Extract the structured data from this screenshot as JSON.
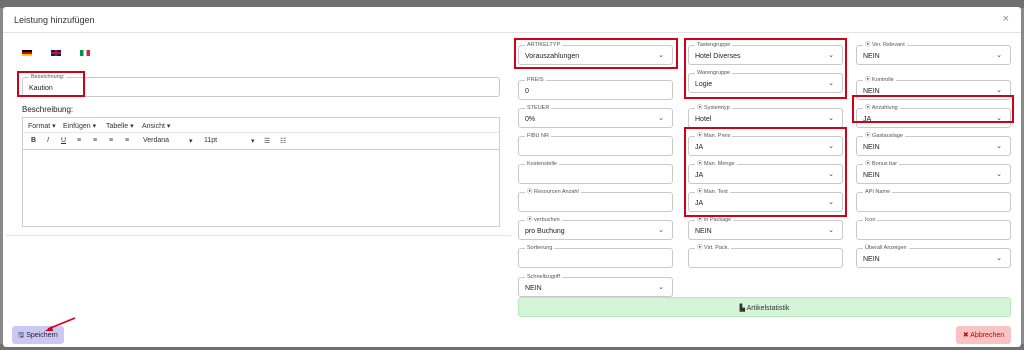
{
  "modal": {
    "title": "Leistung hinzufügen",
    "close": "×"
  },
  "flags": [
    "de",
    "gb",
    "it"
  ],
  "bezeichnung": {
    "label": "Bezeichnung:",
    "value": "Kaution"
  },
  "beschreibung": {
    "label": "Beschreibung:"
  },
  "editor": {
    "menu": [
      "Format",
      "Einfügen",
      "Tabelle",
      "Ansicht"
    ],
    "bold": "B",
    "italic": "I",
    "underline": "U",
    "font": "Verdana",
    "size": "11pt"
  },
  "col1": {
    "artikeltyp": {
      "label": "ARTIKELTYP",
      "value": "Vorauszahlungen"
    },
    "preis": {
      "label": "PREIS",
      "value": "0"
    },
    "steuer": {
      "label": "STEUER",
      "value": "0%"
    },
    "fibu": {
      "label": "FIBU NR",
      "value": ""
    },
    "kostenstelle": {
      "label": "Kostenstelle",
      "value": ""
    },
    "resourcen": {
      "label": "⦿ Resourcen Anzahl",
      "value": ""
    },
    "verbuchen": {
      "label": "⦿ verbuchen",
      "value": "pro Buchung"
    },
    "sortierung": {
      "label": "Sortierung",
      "value": ""
    },
    "schnellzugriff": {
      "label": "Schnellzugriff",
      "value": "NEIN"
    }
  },
  "col2": {
    "tastengruppe": {
      "label": "Tastengruppe",
      "value": "Hotel Diverses"
    },
    "warengruppe": {
      "label": "Warengruppe",
      "value": "Logie"
    },
    "systemtyp": {
      "label": "⦿ Systemtyp",
      "value": "Hotel"
    },
    "manpreis": {
      "label": "⦿ Man. Preis",
      "value": "JA"
    },
    "manmenge": {
      "label": "⦿ Man. Menge",
      "value": "JA"
    },
    "mantext": {
      "label": "⦿ Man. Text",
      "value": "JA"
    },
    "inpackage": {
      "label": "⦿ in Package",
      "value": "NEIN"
    },
    "virtpack": {
      "label": "⦿ Virt. Pack.",
      "value": ""
    }
  },
  "col3": {
    "verrelevant": {
      "label": "⦿ Ver. Relevant",
      "value": "NEIN"
    },
    "kontrolle": {
      "label": "⦿ Kontrolle",
      "value": "NEIN"
    },
    "anzahlung": {
      "label": "⦿ Anzahlung",
      "value": "JA"
    },
    "gastauslage": {
      "label": "⦿ Gastauslage",
      "value": "NEIN"
    },
    "bonusbar": {
      "label": "⦿ Bonus bar",
      "value": "NEIN"
    },
    "apiname": {
      "label": "API Name",
      "value": ""
    },
    "icon": {
      "label": "Icon",
      "value": ""
    },
    "ueberall": {
      "label": "Überall Anzeigen",
      "value": "NEIN"
    }
  },
  "buttons": {
    "statistik": "▙ Artikelstatistik",
    "save": "🖫 Speichern",
    "cancel": "✖ Abbrechen"
  },
  "colors": {
    "highlight": "#d0021b",
    "save_bg": "#cbc8f3",
    "cancel_bg": "#f9c3c3",
    "stat_bg": "#d4f5d8"
  }
}
